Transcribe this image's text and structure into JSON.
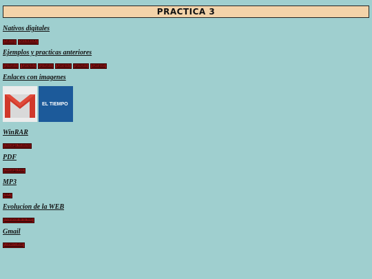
{
  "page": {
    "title": "PRACTICA 3"
  },
  "sections": [
    {
      "heading": "Nativos digitales",
      "links": [
        "Nativos",
        "ABURRIDO"
      ]
    },
    {
      "heading": "Ejemplos y practicas anteriores",
      "links": [
        "Ejemplo1",
        "Ejemplo2",
        "Ejemplo3",
        "Ejemplo4",
        "Ejemplo5",
        "Ejemplo6"
      ]
    },
    {
      "heading": "Enlaces con imagenes",
      "images": [
        {
          "name": "gmail-logo",
          "text": ""
        },
        {
          "name": "el-tiempo-logo",
          "text": "EL TIEMPO"
        }
      ]
    },
    {
      "heading": "WinRAR",
      "links": [
        "Descarga WinRAR"
      ]
    },
    {
      "heading": "PDF",
      "links": [
        "Descarga PDF"
      ]
    },
    {
      "heading": "MP3",
      "links": [
        "MP3"
      ]
    },
    {
      "heading": "Evolucion de la WEB",
      "links": [
        "Evolución de la Web"
      ]
    },
    {
      "heading": "Gmail",
      "links": [
        "Correo Gmail"
      ]
    }
  ]
}
